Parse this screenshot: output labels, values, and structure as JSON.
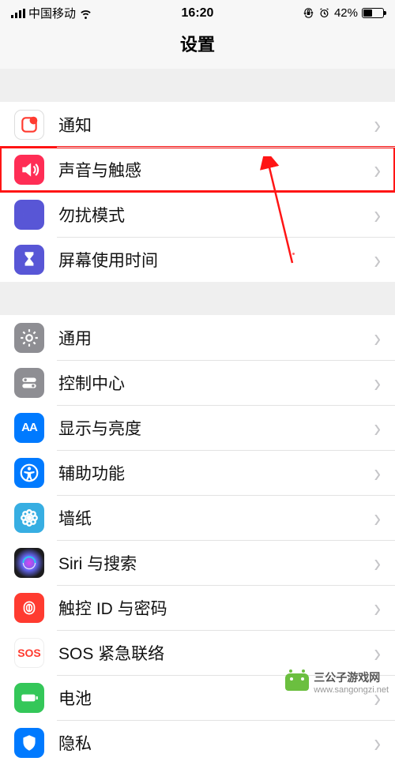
{
  "status": {
    "carrier": "中国移动",
    "time": "16:20",
    "battery_pct": "42%"
  },
  "title": "设置",
  "group1": [
    {
      "key": "notifications",
      "label": "通知",
      "icon": "notification-icon",
      "bg": "#ff3b30"
    },
    {
      "key": "sounds",
      "label": "声音与触感",
      "icon": "sound-icon",
      "bg": "#ff2d55",
      "highlighted": true
    },
    {
      "key": "dnd",
      "label": "勿扰模式",
      "icon": "moon-icon",
      "bg": "#5856d6"
    },
    {
      "key": "screentime",
      "label": "屏幕使用时间",
      "icon": "hourglass-icon",
      "bg": "#5856d6"
    }
  ],
  "group2": [
    {
      "key": "general",
      "label": "通用",
      "icon": "gear-icon",
      "bg": "#8e8e93"
    },
    {
      "key": "control-center",
      "label": "控制中心",
      "icon": "switches-icon",
      "bg": "#8e8e93"
    },
    {
      "key": "display",
      "label": "显示与亮度",
      "icon": "aa-icon",
      "bg": "#007aff"
    },
    {
      "key": "accessibility",
      "label": "辅助功能",
      "icon": "accessibility-icon",
      "bg": "#007aff"
    },
    {
      "key": "wallpaper",
      "label": "墙纸",
      "icon": "flower-icon",
      "bg": "#37aee2"
    },
    {
      "key": "siri",
      "label": "Siri 与搜索",
      "icon": "siri-icon",
      "bg": "#1c1c1e"
    },
    {
      "key": "touchid",
      "label": "触控 ID 与密码",
      "icon": "fingerprint-icon",
      "bg": "#ff3b30"
    },
    {
      "key": "sos",
      "label": "SOS 紧急联络",
      "icon": "sos-icon",
      "bg": "#ffffff"
    },
    {
      "key": "battery",
      "label": "电池",
      "icon": "battery-icon",
      "bg": "#34c759"
    },
    {
      "key": "privacy",
      "label": "隐私",
      "icon": "hand-icon",
      "bg": "#007aff"
    }
  ],
  "watermark": {
    "text": "三公子游戏网",
    "url": "www.sangongzi.net"
  }
}
